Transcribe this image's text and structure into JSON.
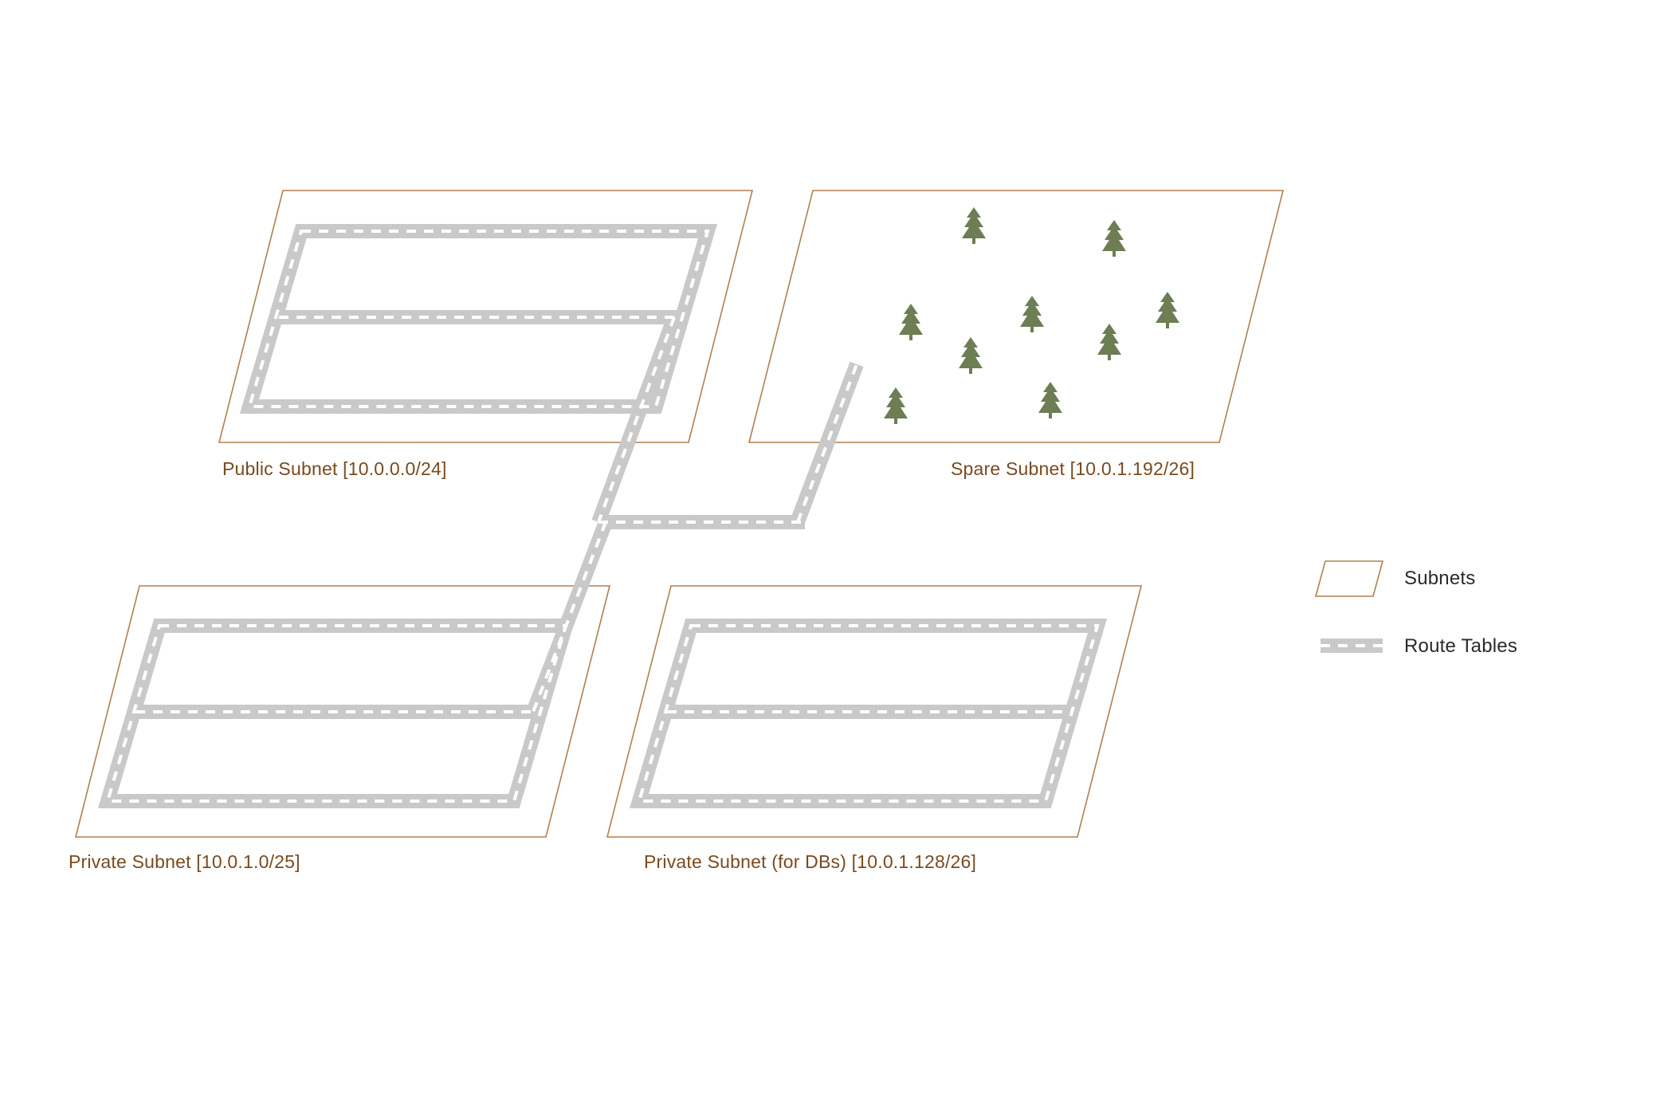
{
  "subnets": {
    "public": {
      "label": "Public Subnet [10.0.0.0/24]"
    },
    "private": {
      "label": "Private Subnet [10.0.1.0/25]"
    },
    "privateDb": {
      "label": "Private Subnet (for DBs) [10.0.1.128/26]"
    },
    "spare": {
      "label": "Spare Subnet [10.0.1.192/26]"
    }
  },
  "legend": {
    "subnets": "Subnets",
    "routeTables": "Route Tables"
  },
  "colors": {
    "subnetStroke": "#b08050",
    "subnetLabel": "#7a4a1f",
    "road": "#c9c9c9",
    "roadDash": "#ffffff",
    "tree": "#6d7d54",
    "text": "#2a2a2a"
  }
}
